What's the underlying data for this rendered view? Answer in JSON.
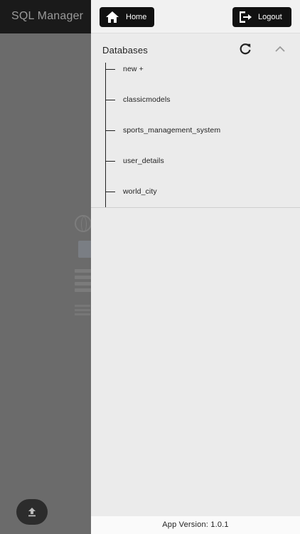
{
  "app": {
    "title": "SQL Manager"
  },
  "drawer": {
    "home_label": "Home",
    "logout_label": "Logout",
    "section_title": "Databases",
    "databases": [
      {
        "label": "new +"
      },
      {
        "label": "classicmodels"
      },
      {
        "label": "sports_management_system"
      },
      {
        "label": "user_details"
      },
      {
        "label": "world_city"
      }
    ],
    "footer": "App Version: 1.0.1"
  },
  "icons": {
    "home": "home-icon",
    "logout": "logout-icon",
    "refresh": "refresh-icon",
    "collapse": "chevron-up-icon",
    "upload": "upload-icon"
  }
}
